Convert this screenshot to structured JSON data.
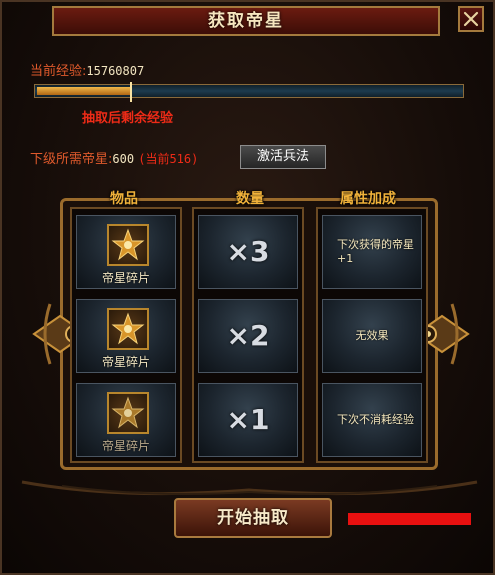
{
  "window": {
    "title": "获取帝星",
    "close_icon": "close-icon"
  },
  "experience": {
    "label": "当前经验:",
    "value": "15760807",
    "marker_label": "抽取后剩余经验",
    "fill_fraction": 0.22
  },
  "requirement": {
    "label": "下级所需帝星:",
    "value": "600",
    "current": "(当前516)"
  },
  "activate_button": {
    "label": "激活兵法"
  },
  "columns": {
    "item_header": "物品",
    "quantity_header": "数量",
    "bonus_header": "属性加成"
  },
  "rows": [
    {
      "item_name": "帝星碎片",
      "quantity": "×3",
      "bonus": "下次获得的帝星+1",
      "item_icon": "star-shard-icon"
    },
    {
      "item_name": "帝星碎片",
      "quantity": "×2",
      "bonus": "无效果",
      "item_icon": "star-shard-icon"
    },
    {
      "item_name": "帝星碎片",
      "quantity": "×1",
      "bonus": "下次不消耗经验",
      "item_icon": "star-shard-icon"
    }
  ],
  "start_button": {
    "label": "开始抽取"
  },
  "colors": {
    "accent_red": "#ee2b17",
    "label_orange": "#e05a2c",
    "gold": "#f0b23a",
    "status_bar": "#e81010"
  }
}
